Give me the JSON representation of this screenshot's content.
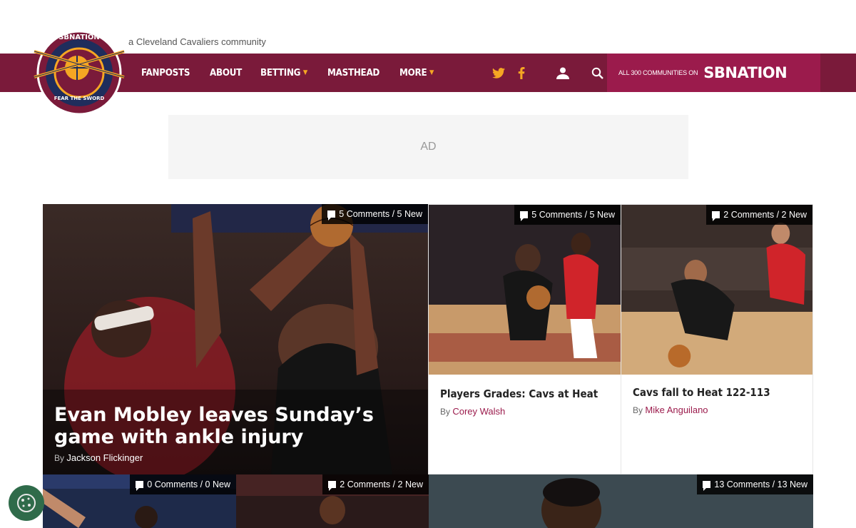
{
  "header": {
    "tagline": "a Cleveland Cavaliers community",
    "logo": {
      "top_text": "SBNATION",
      "bottom_text": "FEAR THE SWORD"
    },
    "nav": [
      {
        "label": "FANPOSTS",
        "dropdown": false
      },
      {
        "label": "ABOUT",
        "dropdown": false
      },
      {
        "label": "BETTING",
        "dropdown": true
      },
      {
        "label": "MASTHEAD",
        "dropdown": false
      },
      {
        "label": "MORE",
        "dropdown": true
      }
    ],
    "icons": [
      "twitter-icon",
      "facebook-icon",
      "user-icon",
      "search-icon"
    ],
    "network": {
      "small": "ALL 300 COMMUNITIES ON",
      "brand": "SBNATION"
    }
  },
  "ad": {
    "label": "AD"
  },
  "articles": {
    "hero": {
      "comments": "5 Comments / 5 New",
      "title": "Evan Mobley leaves Sunday’s game with ankle injury",
      "by": "By",
      "author": "Jackson Flickinger"
    },
    "card2": {
      "comments": "5 Comments / 5 New",
      "title": "Players Grades: Cavs at Heat",
      "by": "By",
      "author": "Corey Walsh"
    },
    "card3": {
      "comments": "2 Comments / 2 New",
      "title": "Cavs fall to Heat 122-113",
      "by": "By",
      "author": "Mike Anguilano"
    },
    "row2": [
      {
        "comments": "0 Comments / 0 New"
      },
      {
        "comments": "2 Comments / 2 New"
      },
      {
        "comments": "13 Comments / 13 New"
      }
    ]
  },
  "colors": {
    "nav_bg": "#7a1a3a",
    "sbn_bg": "#9b1b4c",
    "accent": "#f5a623"
  }
}
